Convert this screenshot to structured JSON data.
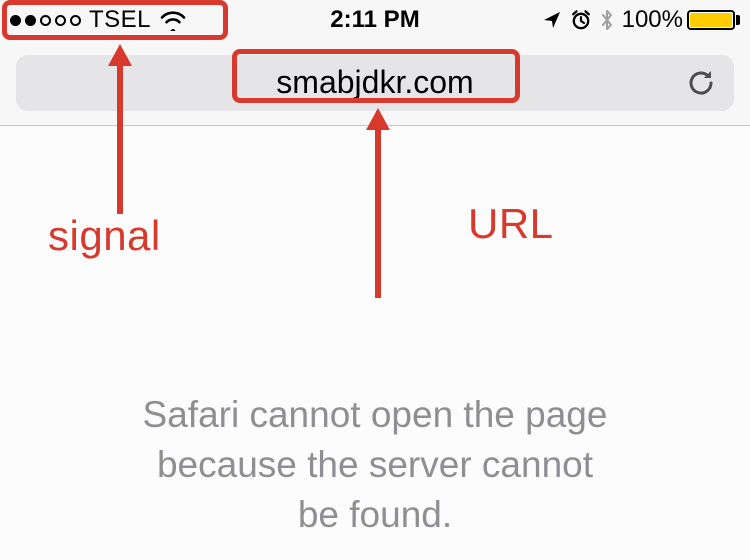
{
  "status_bar": {
    "signal_dots_filled": 2,
    "signal_dots_total": 5,
    "carrier": "TSEL",
    "time": "2:11 PM",
    "battery_pct": "100%"
  },
  "nav_bar": {
    "url": "smabjdkr.com"
  },
  "page": {
    "error_line1": "Safari cannot open the page",
    "error_line2": "because the server cannot",
    "error_line3": "be found."
  },
  "annotations": {
    "signal_label": "signal",
    "url_label": "URL"
  }
}
